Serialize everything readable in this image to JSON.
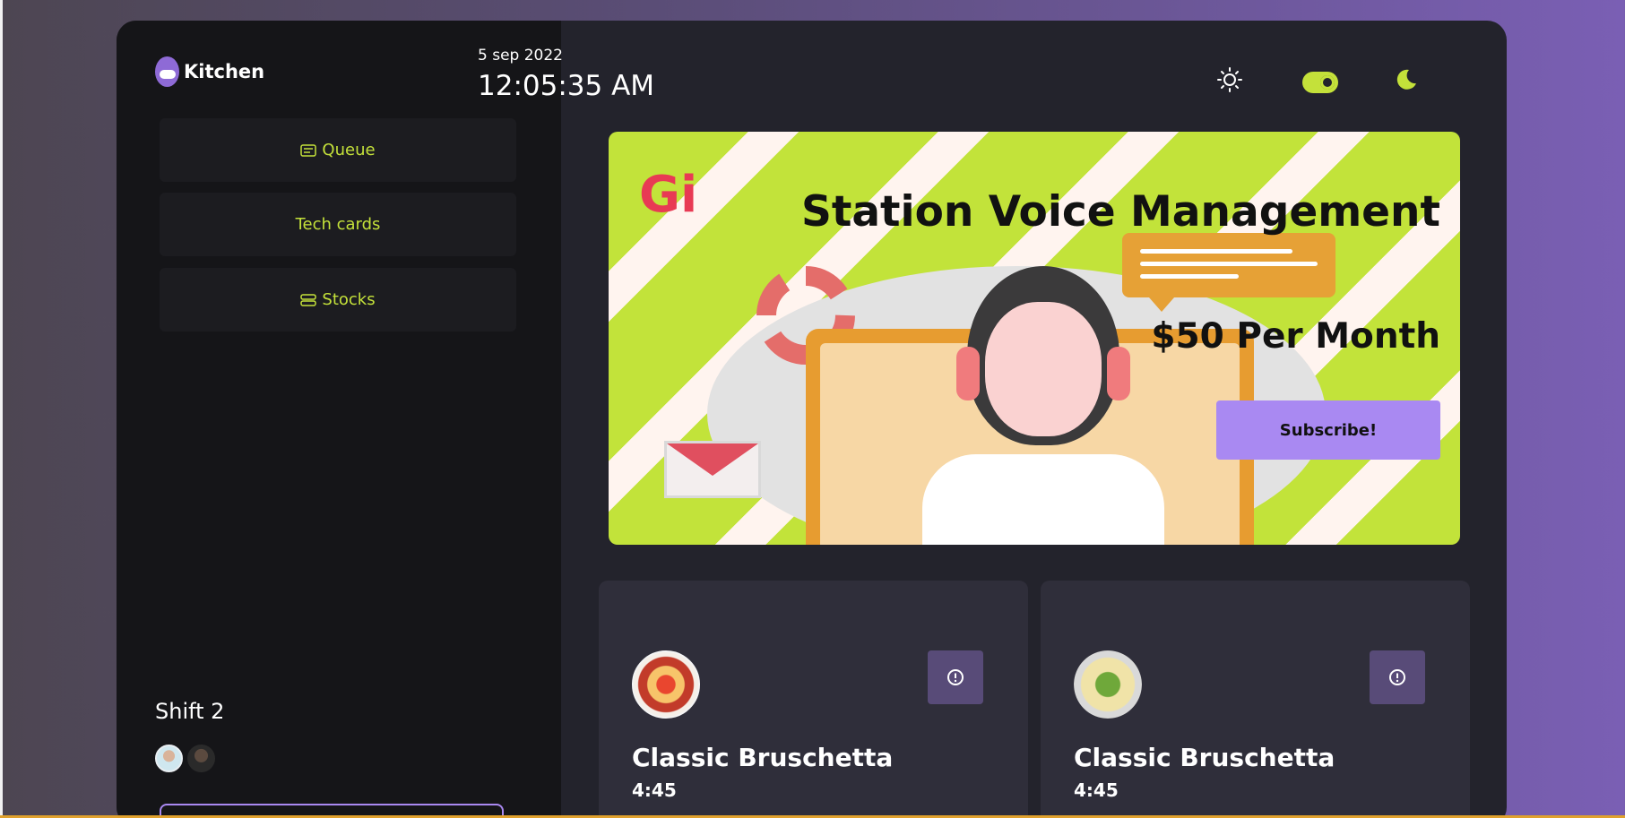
{
  "app": {
    "name": "Kitchen"
  },
  "nav": {
    "queue": "Queue",
    "tech_cards": "Tech cards",
    "stocks": "Stocks"
  },
  "shift": {
    "label": "Shift 2"
  },
  "header": {
    "date": "5 sep 2022",
    "time": "12:05:35 AM"
  },
  "theme": {
    "sun_icon": "sun-icon",
    "toggle": "on",
    "moon_icon": "moon-icon"
  },
  "banner": {
    "logo": "Gi",
    "title": "Station Voice Management",
    "price": "$50 Per Month",
    "cta": "Subscribe!"
  },
  "cards": [
    {
      "name": "Classic Bruschetta",
      "time": "4:45"
    },
    {
      "name": "Classic Bruschetta",
      "time": "4:45"
    }
  ],
  "colors": {
    "accent": "#c4e13a",
    "purple": "#a989f2",
    "panel": "#151518",
    "main_bg": "#23232c"
  }
}
